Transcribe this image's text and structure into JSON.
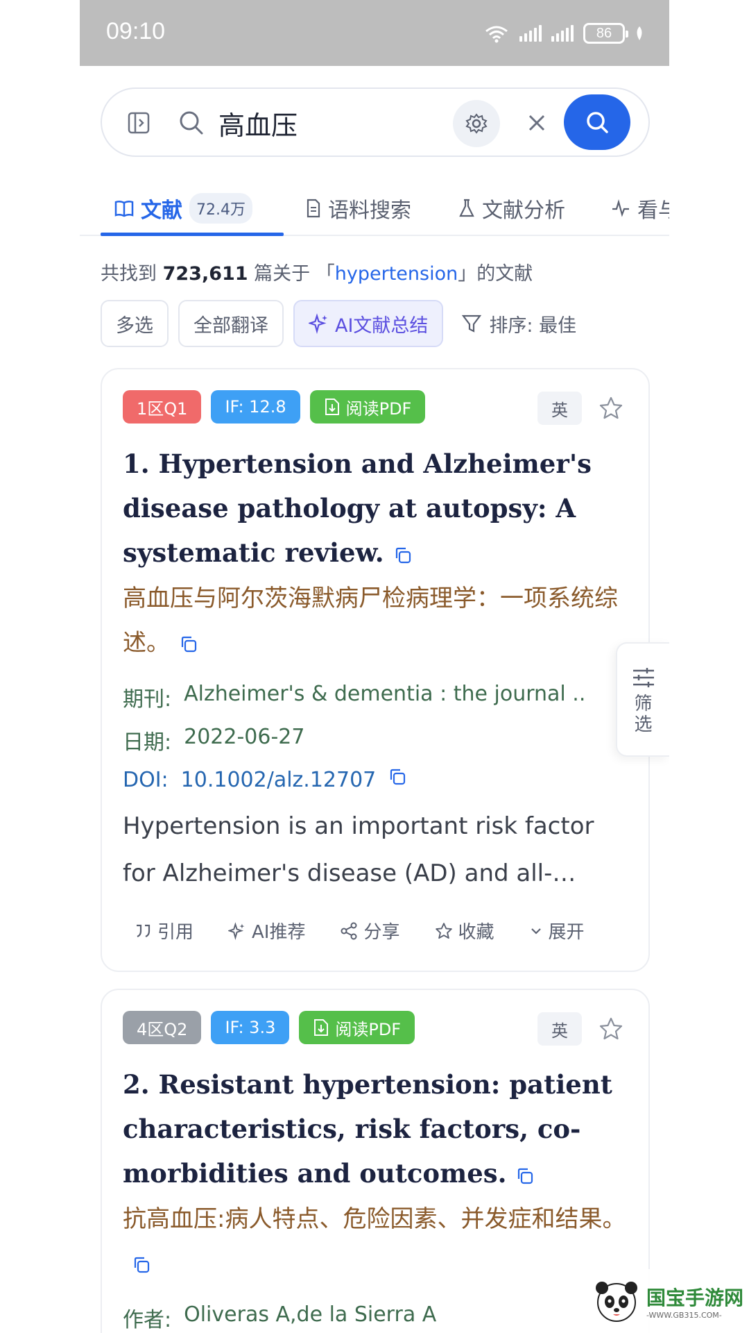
{
  "status": {
    "time": "09:10",
    "battery": "86"
  },
  "search": {
    "query": "高血压"
  },
  "tabs": [
    {
      "label": "文献",
      "count": "72.4万"
    },
    {
      "label": "语料搜索"
    },
    {
      "label": "文献分析"
    },
    {
      "label": "看与"
    }
  ],
  "summary": {
    "prefix": "共找到",
    "count": "723,611",
    "middle": "篇关于 「",
    "keyword": "hypertension",
    "suffix": "」的文献"
  },
  "actions": {
    "multi_select": "多选",
    "translate_all": "全部翻译",
    "ai_summary": "AI文献总结",
    "sort": "排序: 最佳"
  },
  "results": [
    {
      "zone": "1区Q1",
      "impact": "IF: 12.8",
      "pdf": "阅读PDF",
      "lang": "英",
      "title": "1. Hypertension and Alzheimer's disease pathology at autopsy: A systematic review.",
      "title_cn": "高血压与阿尔茨海默病尸检病理学：一项系统综述。",
      "journal_label": "期刊:",
      "journal": "Alzheimer's & dementia : the journal ..",
      "date_label": "日期:",
      "date": "2022-06-27",
      "doi_label": "DOI:",
      "doi": "10.1002/alz.12707",
      "abstract": "Hypertension is an important risk factor for Alzheimer's disease (AD) and all-…",
      "footer": {
        "cite": "引用",
        "ai_recommend": "AI推荐",
        "share": "分享",
        "favorite": "收藏",
        "expand": "展开"
      }
    },
    {
      "zone": "4区Q2",
      "impact": "IF: 3.3",
      "pdf": "阅读PDF",
      "lang": "英",
      "title": "2. Resistant hypertension: patient characteristics, risk factors, co-morbidities and outcomes.",
      "title_cn": "抗高血压:病人特点、危险因素、并发症和结果。",
      "author_label": "作者:",
      "authors": "Oliveras A,de la Sierra A"
    }
  ],
  "filter": {
    "label": "筛选"
  },
  "watermark": {
    "name": "国宝手游网",
    "url": "-WWW.GB315.COM-"
  },
  "colors": {
    "accent": "#2566e8",
    "zone_top": "#f06a6a",
    "zone_low": "#9aa0a8",
    "impact": "#3ea0f5",
    "pdf": "#55bf4a"
  }
}
